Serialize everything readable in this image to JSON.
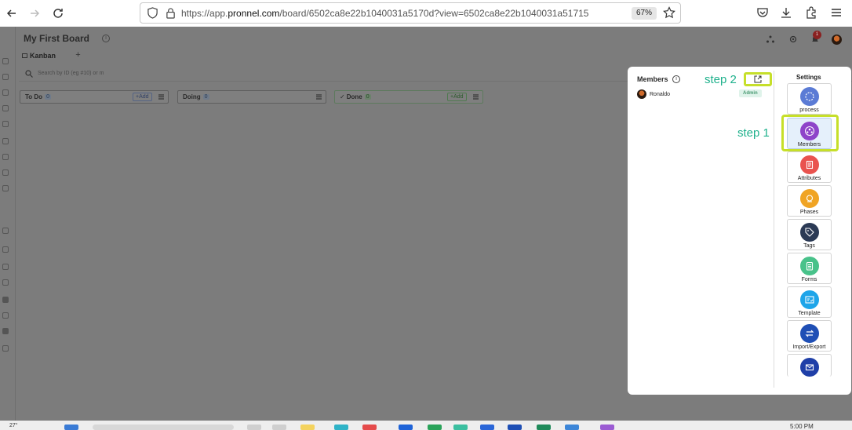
{
  "browser": {
    "url_prefix": "https://app.",
    "url_host": "pronnel.com",
    "url_rest": "/board/6502ca8e22b1040031a5170d?view=6502ca8e22b1040031a51715",
    "zoom": "67%"
  },
  "board": {
    "title": "My First Board",
    "view_tab": "Kanban",
    "search_placeholder": "Search by ID (eg #10) or m",
    "notification_count": "1",
    "columns": [
      {
        "name": "To Do",
        "count": "0",
        "add_label": "+Add"
      },
      {
        "name": "Doing",
        "count": "0"
      },
      {
        "name": "Done",
        "count": "0",
        "add_label": "+Add"
      }
    ]
  },
  "panel": {
    "members_title": "Members",
    "member_name": "Ronaldo",
    "member_role": "Admin",
    "settings_title": "Settings",
    "step1": "step 1",
    "step2": "step 2",
    "settings": [
      {
        "label": "process",
        "icon": "process-icon",
        "color": "#5b7bd5"
      },
      {
        "label": "Members",
        "icon": "members-icon",
        "color": "#8e44c9"
      },
      {
        "label": "Attributes",
        "icon": "attributes-icon",
        "color": "#e9534f"
      },
      {
        "label": "Phases",
        "icon": "phases-icon",
        "color": "#f0a424"
      },
      {
        "label": "Tags",
        "icon": "tags-icon",
        "color": "#2b3a55"
      },
      {
        "label": "Forms",
        "icon": "forms-icon",
        "color": "#48c28a"
      },
      {
        "label": "Template",
        "icon": "template-icon",
        "color": "#1ea5e9"
      },
      {
        "label": "Import/Export",
        "icon": "import-export-icon",
        "color": "#1f4fb5"
      },
      {
        "label": "",
        "icon": "mail-icon",
        "color": "#1f3fa8"
      }
    ]
  },
  "taskbar": {
    "left_text": "27°",
    "time_text": "5:00 PM"
  }
}
